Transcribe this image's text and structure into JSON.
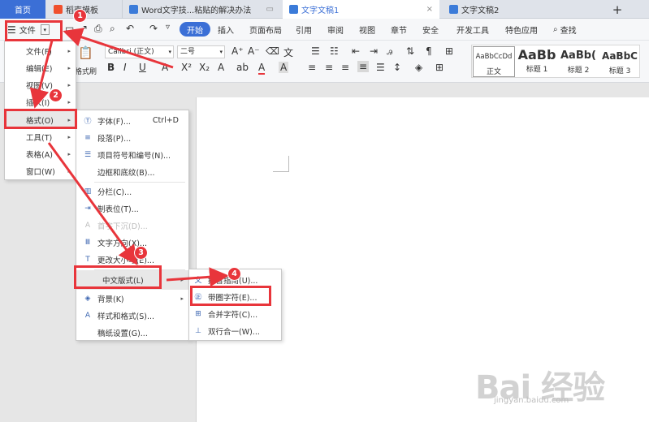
{
  "tabs": [
    {
      "label": "首页",
      "active": true
    },
    {
      "label": "稻壳模板"
    },
    {
      "label": "Word文字技...粘贴的解决办法"
    },
    {
      "label": "文字文稿1",
      "selected": true
    },
    {
      "label": "文字文稿2"
    },
    {
      "label": "+"
    }
  ],
  "menubar": {
    "file_label": "文件",
    "tabs": [
      "开始",
      "插入",
      "页面布局",
      "引用",
      "审阅",
      "视图",
      "章节",
      "安全",
      "开发工具",
      "特色应用"
    ],
    "search_label": "查找"
  },
  "ribbon": {
    "font_name": "Calibri (正文)",
    "font_size": "二号",
    "format_painter": "格式刷",
    "styles": [
      {
        "preview": "AaBbCcDd",
        "name": "正文"
      },
      {
        "preview": "AaBb",
        "name": "标题 1"
      },
      {
        "preview": "AaBb(",
        "name": "标题 2"
      },
      {
        "preview": "AaBbC",
        "name": "标题 3"
      }
    ]
  },
  "main_menu": [
    {
      "label": "文件(F)",
      "arrow": true
    },
    {
      "label": "编辑(E)",
      "arrow": true
    },
    {
      "label": "视图(V)",
      "arrow": true
    },
    {
      "label": "插入(I)",
      "arrow": true
    },
    {
      "label": "格式(O)",
      "arrow": true
    },
    {
      "label": "工具(T)",
      "arrow": true
    },
    {
      "label": "表格(A)",
      "arrow": true
    },
    {
      "label": "窗口(W)",
      "arrow": true
    }
  ],
  "format_menu": [
    {
      "icon": "Ⓣ",
      "label": "字体(F)...",
      "shortcut": "Ctrl+D"
    },
    {
      "icon": "≡",
      "label": "段落(P)..."
    },
    {
      "icon": "☰",
      "label": "项目符号和编号(N)..."
    },
    {
      "icon": "",
      "label": "边框和底纹(B)..."
    },
    {
      "icon": "▥",
      "label": "分栏(C)..."
    },
    {
      "icon": "⇥",
      "label": "制表位(T)..."
    },
    {
      "icon": "A",
      "label": "首字下沉(D)...",
      "disabled": true
    },
    {
      "icon": "Ⅲ",
      "label": "文字方向(X)..."
    },
    {
      "icon": "T",
      "label": "更改大小写(E)..."
    },
    {
      "icon": "",
      "label": "中文版式(L)",
      "arrow": true
    },
    {
      "icon": "◈",
      "label": "背景(K)",
      "arrow": true
    },
    {
      "icon": "A",
      "label": "样式和格式(S)..."
    },
    {
      "icon": "",
      "label": "稿纸设置(G)..."
    }
  ],
  "chinese_menu": [
    {
      "icon": "文",
      "label": "拼音指南(U)..."
    },
    {
      "icon": "㊣",
      "label": "带圈字符(E)..."
    },
    {
      "icon": "⊞",
      "label": "合并字符(C)..."
    },
    {
      "icon": "⊥",
      "label": "双行合一(W)..."
    }
  ],
  "badges": [
    "1",
    "2",
    "3",
    "4"
  ],
  "watermark": {
    "text": "Bai 经验",
    "sub": "jingyan.baidu.com"
  },
  "colors": {
    "accent": "#3b6fd6",
    "highlight": "#e8353b",
    "tab_active": "#3b6fd6"
  }
}
